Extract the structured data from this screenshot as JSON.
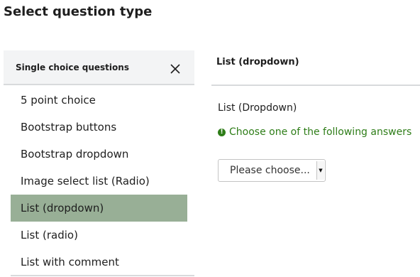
{
  "page": {
    "title": "Select question type"
  },
  "group": {
    "title": "Single choice questions"
  },
  "question_types": [
    {
      "label": "5 point choice",
      "active": false
    },
    {
      "label": "Bootstrap buttons",
      "active": false
    },
    {
      "label": "Bootstrap dropdown",
      "active": false
    },
    {
      "label": "Image select list (Radio)",
      "active": false
    },
    {
      "label": "List (dropdown)",
      "active": true
    },
    {
      "label": "List (radio)",
      "active": false
    },
    {
      "label": "List with comment",
      "active": false
    }
  ],
  "preview": {
    "title": "List (dropdown)",
    "question_text": "List (Dropdown)",
    "hint": "Choose one of the following answers",
    "select_value": "Please choose..."
  },
  "colors": {
    "active_item_bg": "#98af96",
    "hint_green": "#2e7d18",
    "header_bg": "#f3f4f5"
  },
  "icons": {
    "close": "close-icon",
    "hint": "exclamation-circle-icon",
    "dropdown": "caret-down-icon"
  }
}
